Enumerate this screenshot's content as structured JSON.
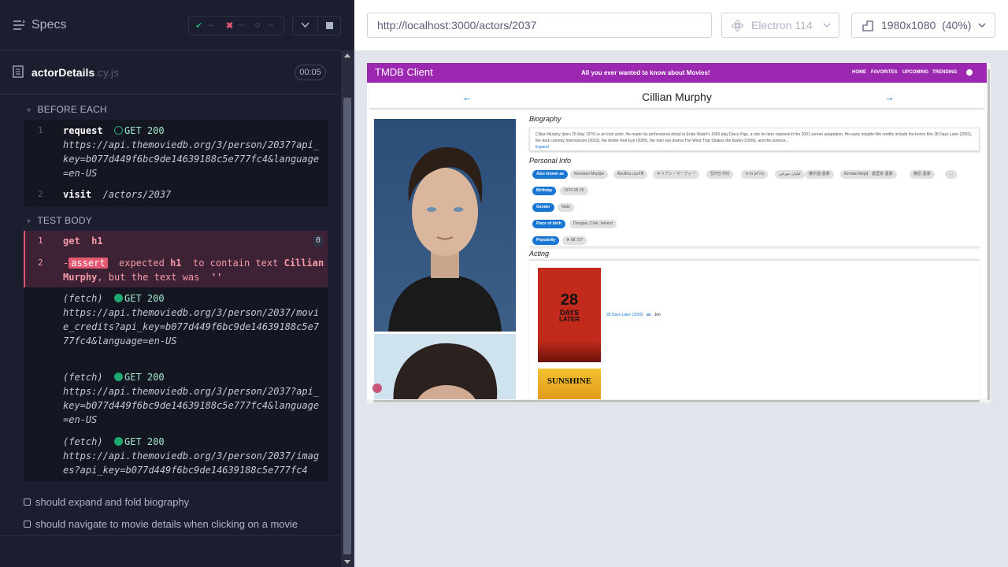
{
  "reporter": {
    "title": "Specs",
    "stats": {
      "passed": "--",
      "failed": "--",
      "pending": "--"
    },
    "file": {
      "name": "actorDetails",
      "ext": ".cy.js",
      "duration": "00:05"
    },
    "before_each": {
      "label": "BEFORE EACH",
      "commands": [
        {
          "num": "1",
          "name": "request",
          "status": "GET 200",
          "arg": "https://api.themoviedb.org/3/person/2037?api_key=b077d449f6bc9de14639188c5e777fc4&language=en-US"
        },
        {
          "num": "2",
          "name": "visit",
          "arg": "/actors/2037"
        }
      ]
    },
    "test_body": {
      "label": "TEST BODY",
      "commands": [
        {
          "num": "1",
          "name": "get",
          "arg": "h1",
          "badge": "0"
        },
        {
          "num": "2",
          "prefix": "-",
          "assert": "assert",
          "text1": "expected",
          "kw1": "h1",
          "text2": "to contain text",
          "kw2": "Cillian Murphy",
          "text3": ", but the text was",
          "text4": "''"
        }
      ],
      "fetches": [
        {
          "name": "(fetch)",
          "status": "GET 200",
          "arg": "https://api.themoviedb.org/3/person/2037/movie_credits?api_key=b077d449f6bc9de14639188c5e777fc4&language=en-US"
        },
        {
          "name": "(fetch)",
          "status": "GET 200",
          "arg": "https://api.themoviedb.org/3/person/2037?api_key=b077d449f6bc9de14639188c5e777fc4&language=en-US"
        },
        {
          "name": "(fetch)",
          "status": "GET 200",
          "arg": "https://api.themoviedb.org/3/person/2037/images?api_key=b077d449f6bc9de14639188c5e777fc4"
        }
      ]
    },
    "tests": [
      "should expand and fold biography",
      "should navigate to movie details when clicking on a movie"
    ]
  },
  "browser": {
    "url": "http://localhost:3000/actors/2037",
    "browser_name": "Electron 114",
    "viewport": "1980x1080",
    "zoom": "(40%)"
  },
  "app": {
    "brand": "TMDB Client",
    "tagline": "All you ever wanted to know about Movies!",
    "nav": [
      "HOME",
      "FAVORITES",
      "UPCOMING",
      "TRENDING"
    ],
    "actor_name": "Cillian Murphy",
    "biography_heading": "Biography",
    "biography": "Cillian Murphy (born 25 May 1976) is an Irish actor. He made his professional debut in Enda Walsh's 1996 play Disco Pigs, a role he later reprised in the 2001 screen adaptation. His early notable film credits include the horror film 28 Days Later (2002), the dark comedy Intermission (2003), the thriller Red Eye (2005), the Irish war drama The Wind That Shakes the Barley (2006), and the science...",
    "expand": "Expand",
    "personal_info_heading": "Personal Info",
    "also_known_as_label": "Also known as",
    "aliases": [
      "Киллиан Мерфи",
      "คิลเลียน เมอร์ฟี",
      "キリアン・マーフィー",
      "킬리언 머피",
      "קיליאן מרפי",
      "كيليان مورفي",
      "席尔迪·墨菲",
      "Кілліан Мерфі",
      "基里安·墨菲",
      "席尼·墨菲"
    ],
    "birthday_label": "Birthday",
    "birthday": "1976-05-25",
    "gender_label": "Gender",
    "gender": "Male",
    "place_label": "Place of birth",
    "place": "Douglas, Cork, Ireland",
    "popularity_label": "Popularity",
    "popularity": "88.737",
    "acting_heading": "Acting",
    "movie_link": "28 Days Later (2002)",
    "as_label": "as",
    "character": "Jim",
    "poster1_text1": "28",
    "poster1_text2": "DAYS",
    "poster1_text3": "LATER",
    "poster2_text": "SUNSHINE"
  },
  "colors": {
    "appbar": "#9c27b0",
    "chip": "#1976d2",
    "fail": "#e45770",
    "ok": "#1fa971"
  }
}
